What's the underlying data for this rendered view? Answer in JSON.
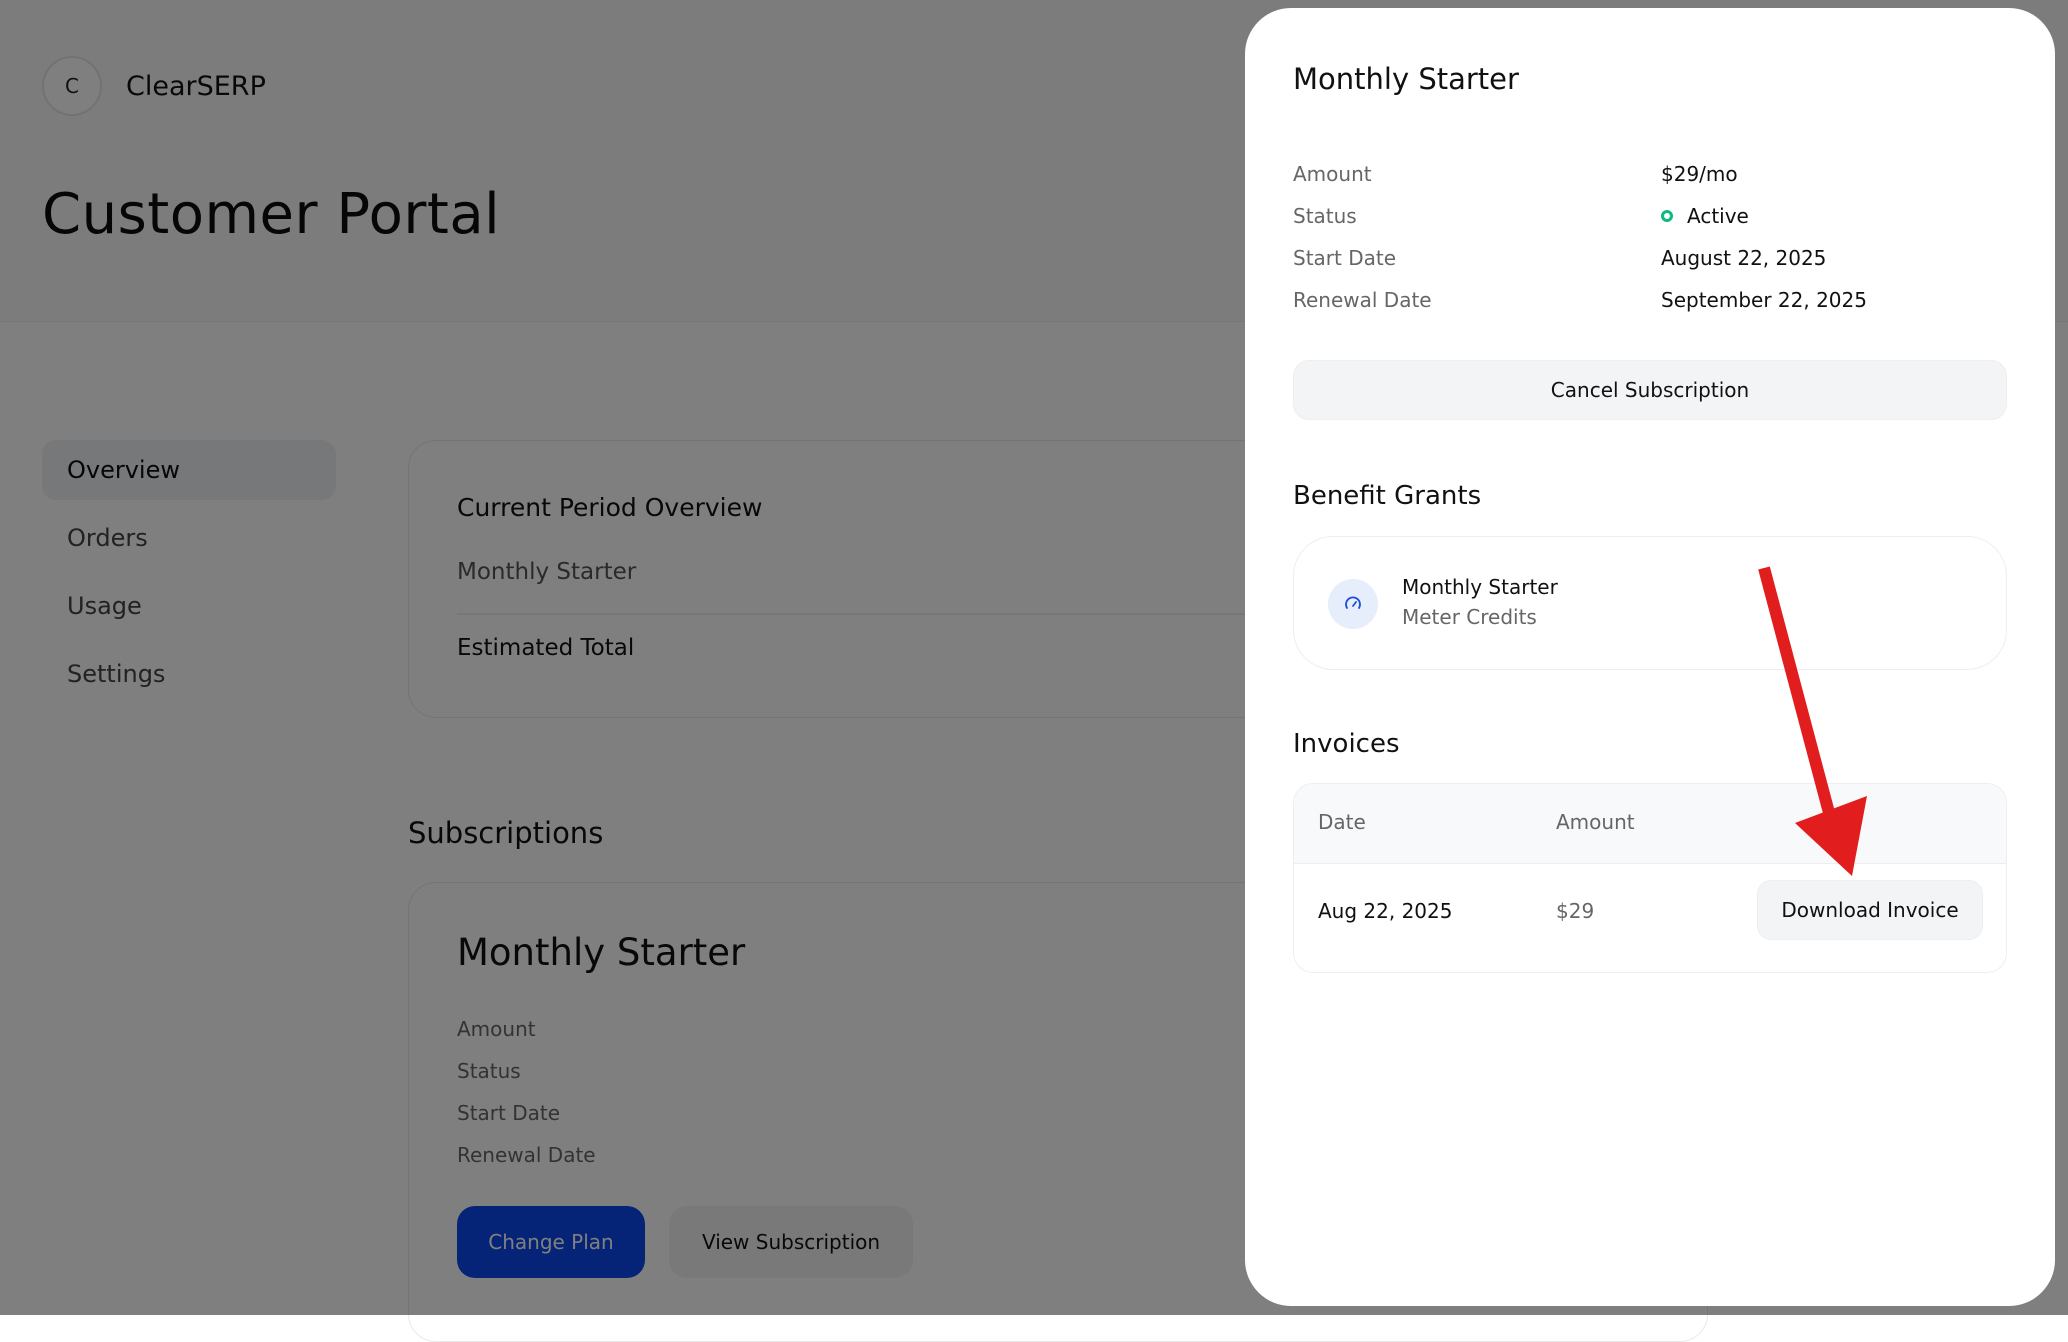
{
  "brand": {
    "initial": "C",
    "name": "ClearSERP"
  },
  "page": {
    "title": "Customer Portal"
  },
  "sidebar": {
    "items": [
      {
        "label": "Overview",
        "active": true
      },
      {
        "label": "Orders"
      },
      {
        "label": "Usage"
      },
      {
        "label": "Settings"
      }
    ]
  },
  "overview": {
    "title": "Current Period Overview",
    "plan": "Monthly Starter",
    "estimated_total_label": "Estimated Total"
  },
  "subscriptions": {
    "heading": "Subscriptions",
    "card": {
      "title": "Monthly Starter",
      "labels": [
        "Amount",
        "Status",
        "Start Date",
        "Renewal Date"
      ],
      "change_plan_label": "Change Plan",
      "view_subscription_label": "View Subscription"
    }
  },
  "drawer": {
    "title": "Monthly Starter",
    "details": [
      {
        "label": "Amount",
        "value": "$29/mo"
      },
      {
        "label": "Status",
        "value": "Active"
      },
      {
        "label": "Start Date",
        "value": "August 22, 2025"
      },
      {
        "label": "Renewal Date",
        "value": "September 22, 2025"
      }
    ],
    "cancel_label": "Cancel Subscription",
    "benefit_grants": {
      "heading": "Benefit Grants",
      "items": [
        {
          "name": "Monthly Starter",
          "type": "Meter Credits",
          "icon": "gauge-icon"
        }
      ]
    },
    "invoices": {
      "heading": "Invoices",
      "columns": [
        "Date",
        "Amount"
      ],
      "rows": [
        {
          "date": "Aug 22, 2025",
          "amount": "$29",
          "action": "Download Invoice"
        }
      ]
    }
  },
  "colors": {
    "accent": "#0a49ee",
    "status_active": "#10b981",
    "annotation_arrow": "#e11d1d",
    "overlay": "#000000"
  }
}
